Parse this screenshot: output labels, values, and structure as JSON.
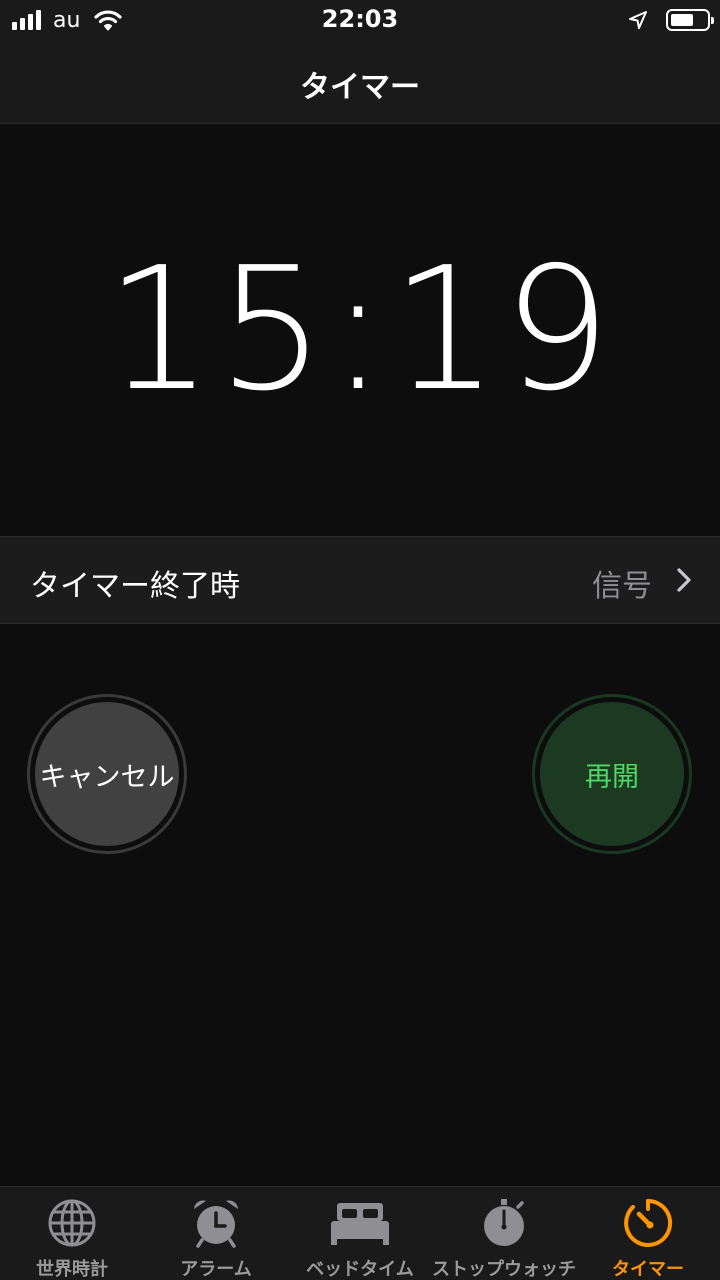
{
  "status_bar": {
    "carrier": "au",
    "time": "22:03",
    "battery_level": 0.65
  },
  "nav": {
    "title": "タイマー"
  },
  "timer": {
    "remaining": "15:19"
  },
  "end_action": {
    "label": "タイマー終了時",
    "value": "信号"
  },
  "buttons": {
    "cancel_label": "キャンセル",
    "resume_label": "再開"
  },
  "tabs": [
    {
      "label": "世界時計",
      "icon": "globe-icon",
      "active": false
    },
    {
      "label": "アラーム",
      "icon": "alarm-clock-icon",
      "active": false
    },
    {
      "label": "ベッドタイム",
      "icon": "bed-icon",
      "active": false
    },
    {
      "label": "ストップウォッチ",
      "icon": "stopwatch-icon",
      "active": false
    },
    {
      "label": "タイマー",
      "icon": "timer-icon",
      "active": true
    }
  ],
  "colors": {
    "accent": "#ff9500",
    "resume_text": "#4cd964",
    "resume_bg": "#1c3a22",
    "cancel_bg": "#414141",
    "background": "#0d0d0d"
  }
}
